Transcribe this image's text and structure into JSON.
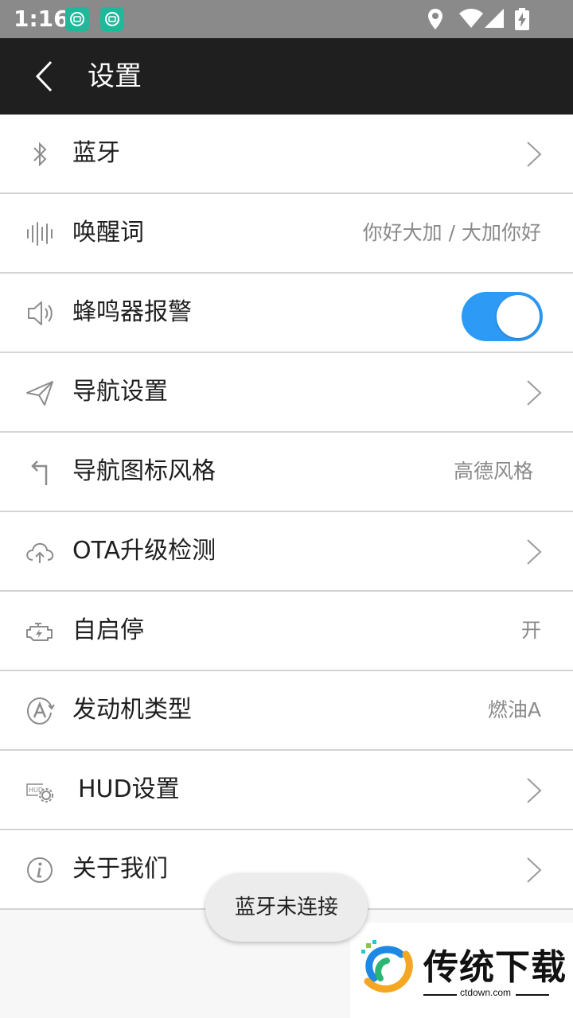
{
  "status_bar": {
    "time": "1:16"
  },
  "app_bar": {
    "title": "设置"
  },
  "settings": {
    "bluetooth": {
      "label": "蓝牙"
    },
    "wake_word": {
      "label": "唤醒词",
      "value": "你好大加 / 大加你好"
    },
    "buzzer_alarm": {
      "label": "蜂鸣器报警",
      "enabled": true
    },
    "navigation_settings": {
      "label": "导航设置"
    },
    "navigation_icon_style": {
      "label": "导航图标风格",
      "value": "高德风格"
    },
    "ota_check": {
      "label": "OTA升级检测"
    },
    "auto_start_stop": {
      "label": "自启停",
      "value": "开"
    },
    "engine_type": {
      "label": "发动机类型",
      "value": "燃油A"
    },
    "hud_settings": {
      "label": "HUD设置"
    },
    "about_us": {
      "label": "关于我们"
    }
  },
  "toast": {
    "message": "蓝牙未连接"
  },
  "watermark": {
    "brand": "传统下载",
    "url": "ctdown.com"
  },
  "colors": {
    "toggle_on": "#2d9bf5",
    "app_bar": "#1f1f1f",
    "status_bar": "#8a8a8a",
    "notification_icon": "#1fb89a"
  }
}
